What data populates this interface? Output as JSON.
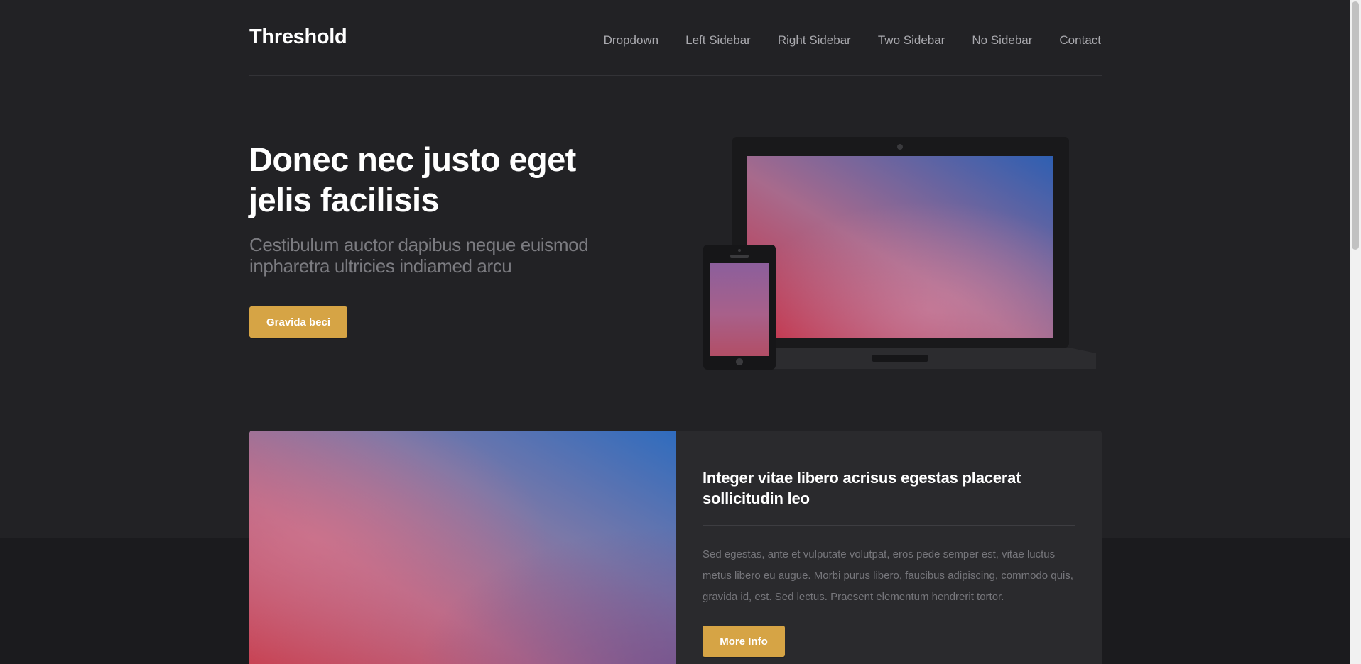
{
  "header": {
    "brand": "Threshold",
    "nav": [
      "Dropdown",
      "Left Sidebar",
      "Right Sidebar",
      "Two Sidebar",
      "No Sidebar",
      "Contact"
    ]
  },
  "hero": {
    "title": "Donec nec justo eget jelis facilisis",
    "subtitle": "Cestibulum auctor dapibus neque euismod inpharetra ultricies indiamed arcu",
    "button_label": "Gravida beci"
  },
  "feature": {
    "title": "Integer vitae libero acrisus egestas placerat sollicitudin leo",
    "text": "Sed egestas, ante et vulputate volutpat, eros pede semper est, vitae luctus metus libero eu augue. Morbi purus libero, faucibus adipiscing, commodo quis, gravida id, est. Sed lectus. Praesent elementum hendrerit tortor.",
    "button_label": "More Info"
  },
  "colors": {
    "background": "#222225",
    "accent": "#d6a445",
    "text_primary": "#ffffff",
    "text_muted": "#7b7b80"
  }
}
